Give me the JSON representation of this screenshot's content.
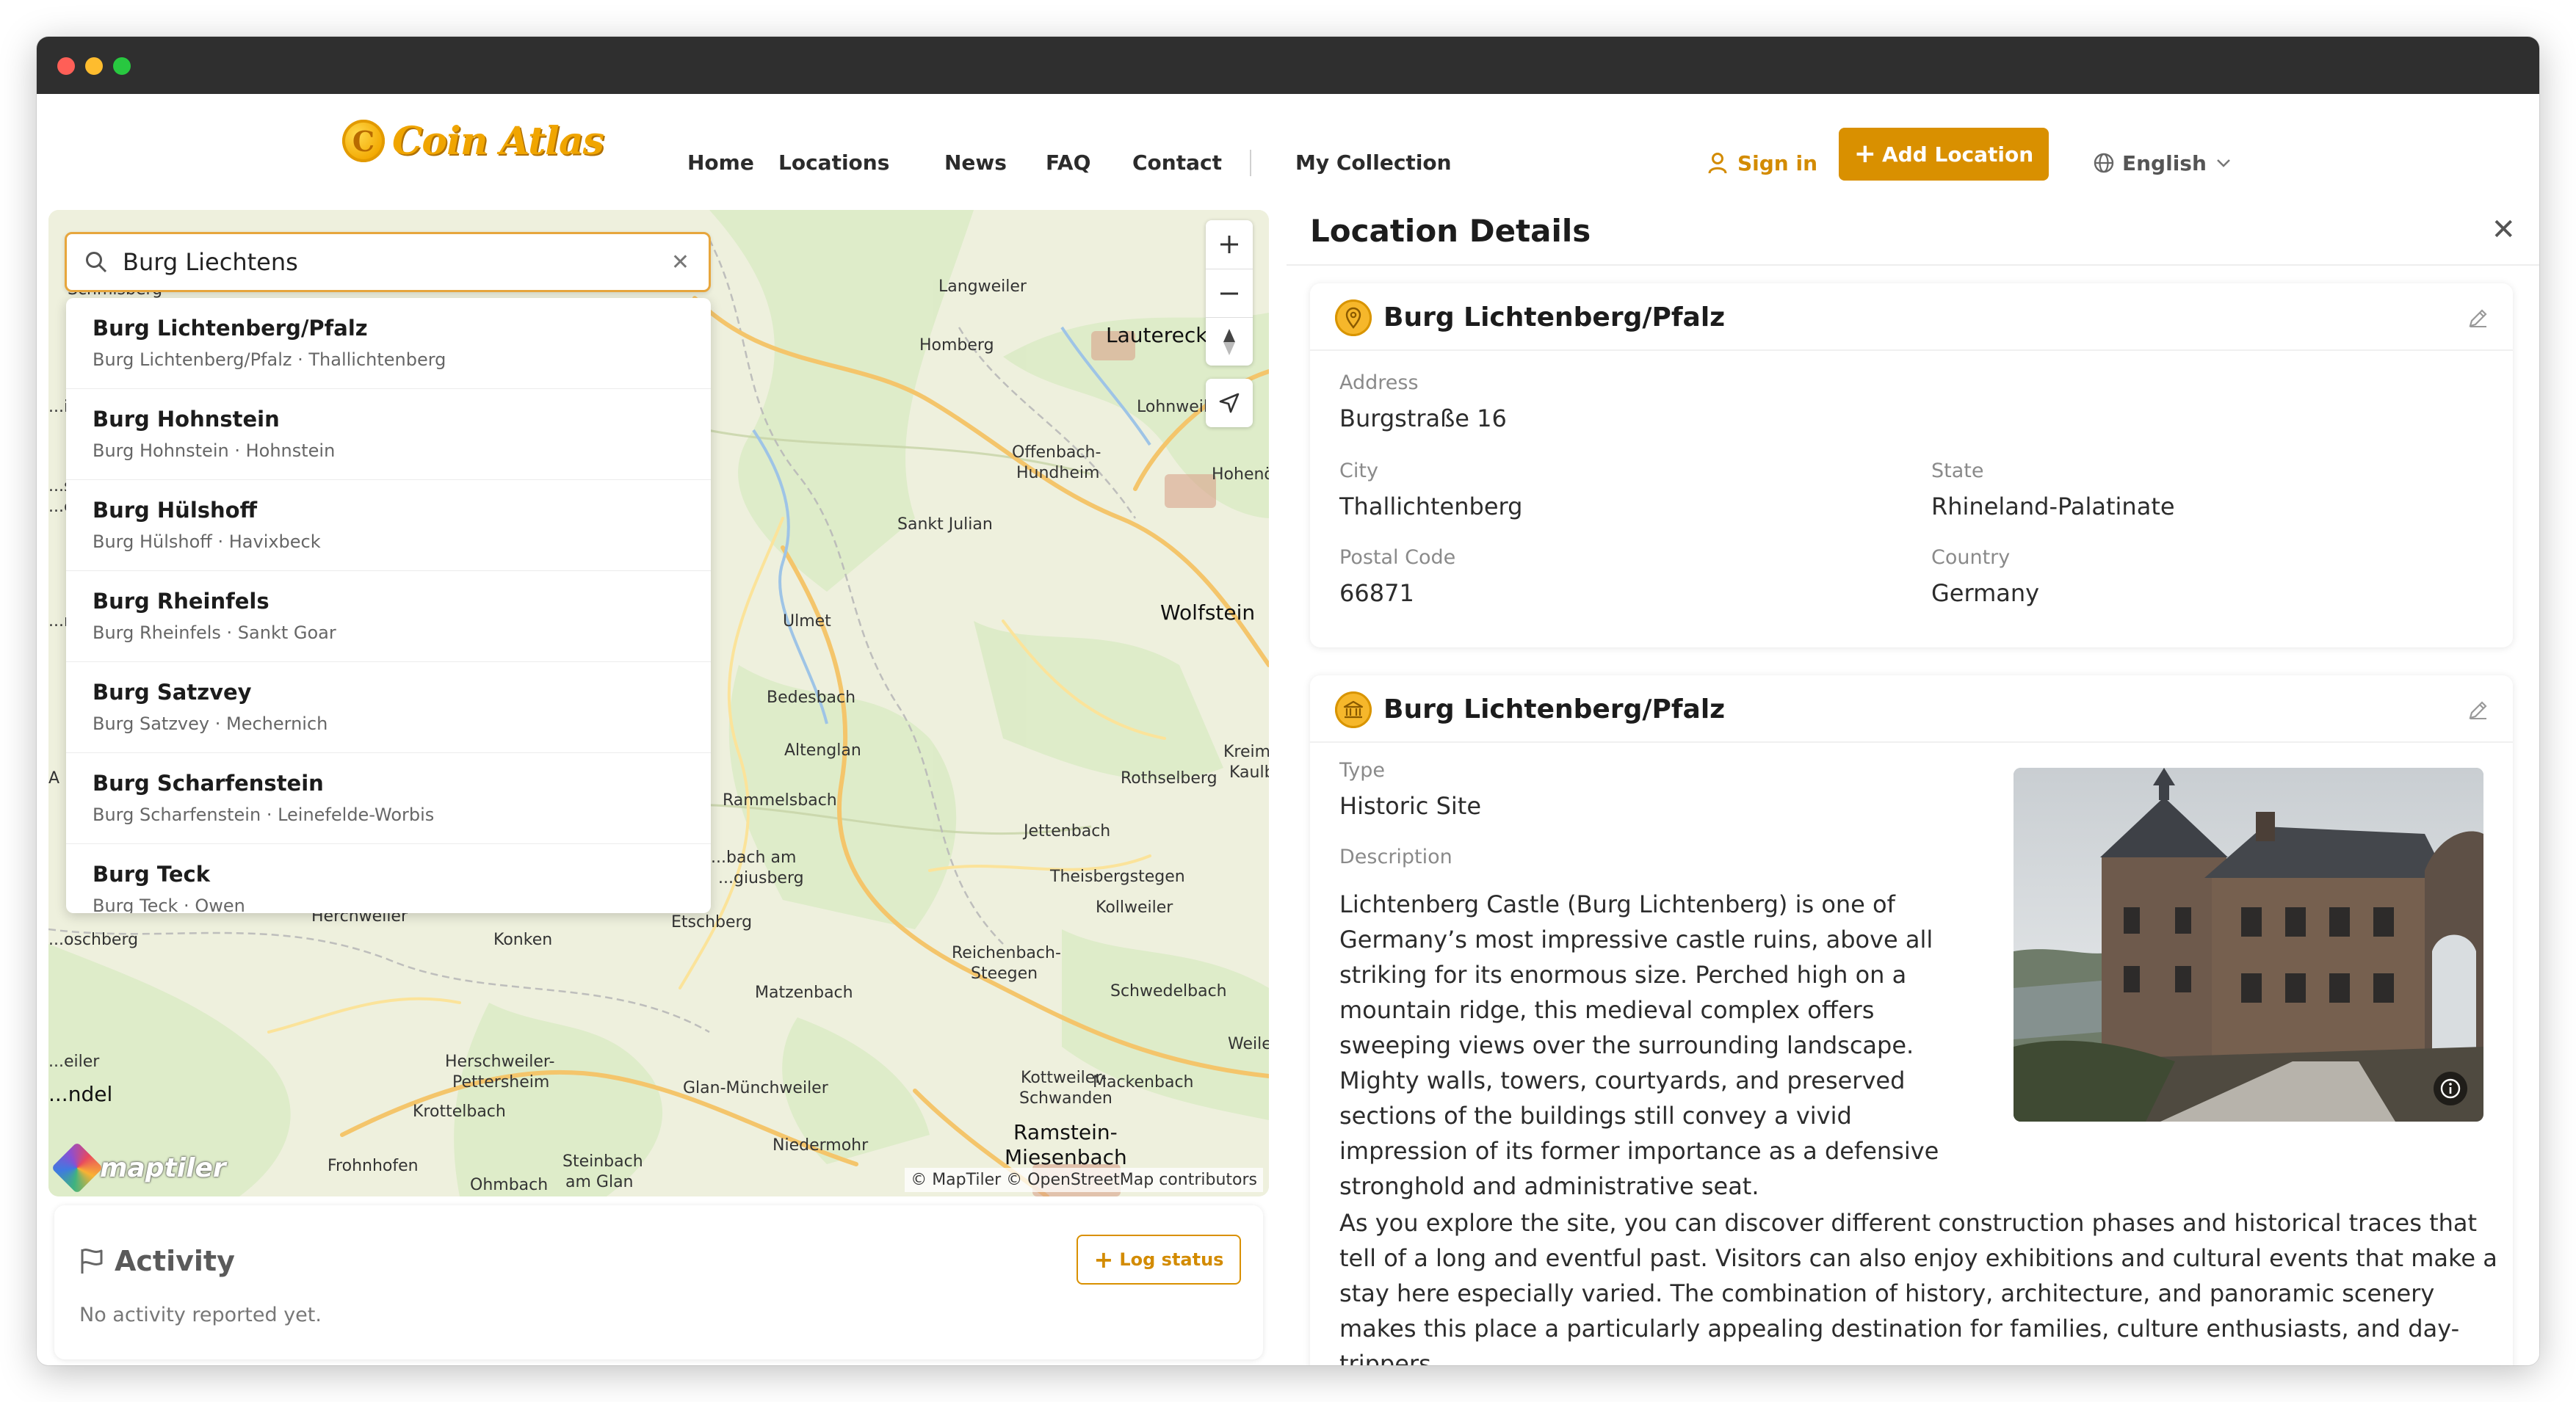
{
  "brand": {
    "name": "Coin Atlas",
    "coin_glyph": "C",
    "accent": "#d99000"
  },
  "nav": {
    "items": [
      {
        "label": "Home"
      },
      {
        "label": "Locations"
      },
      {
        "label": "News"
      },
      {
        "label": "FAQ"
      },
      {
        "label": "Contact"
      },
      {
        "label": "My Collection"
      }
    ],
    "sign_in": "Sign in",
    "add_location": "Add Location",
    "language": "English"
  },
  "search": {
    "value": "Burg Liechtens",
    "results": [
      {
        "title": "Burg Lichtenberg/Pfalz",
        "subtitle": "Burg Lichtenberg/Pfalz · Thallichtenberg"
      },
      {
        "title": "Burg Hohnstein",
        "subtitle": "Burg Hohnstein · Hohnstein"
      },
      {
        "title": "Burg Hülshoff",
        "subtitle": "Burg Hülshoff · Havixbeck"
      },
      {
        "title": "Burg Rheinfels",
        "subtitle": "Burg Rheinfels · Sankt Goar"
      },
      {
        "title": "Burg Satzvey",
        "subtitle": "Burg Satzvey · Mechernich"
      },
      {
        "title": "Burg Scharfenstein",
        "subtitle": "Burg Scharfenstein · Leinefelde-Worbis"
      },
      {
        "title": "Burg Teck",
        "subtitle": "Burg Teck · Owen"
      }
    ]
  },
  "map": {
    "labels": [
      {
        "text": "Schmisberg"
      },
      {
        "text": "Langweiler"
      },
      {
        "text": "Homberg"
      },
      {
        "text": "Lauterecken"
      },
      {
        "text": "Lohnweiler"
      },
      {
        "text": "Offenbach-"
      },
      {
        "text": "Hundheim"
      },
      {
        "text": "Hohenöllen"
      },
      {
        "text": "Sankt Julian"
      },
      {
        "text": "Ulmet"
      },
      {
        "text": "Wolfstein"
      },
      {
        "text": "Bedesbach"
      },
      {
        "text": "Altenglan"
      },
      {
        "text": "Rothselberg"
      },
      {
        "text": "Kreimbach-"
      },
      {
        "text": "Kaulbach"
      },
      {
        "text": "Rammelsbach"
      },
      {
        "text": "Jettenbach"
      },
      {
        "text": "Theisbergstegen"
      },
      {
        "text": "...bach am"
      },
      {
        "text": "...giusberg"
      },
      {
        "text": "Kollweiler"
      },
      {
        "text": "Herchweiler"
      },
      {
        "text": "Konken"
      },
      {
        "text": "Etschberg"
      },
      {
        "text": "...oschberg"
      },
      {
        "text": "Reichenbach-"
      },
      {
        "text": "Steegen"
      },
      {
        "text": "Matzenbach"
      },
      {
        "text": "Schwedelbach"
      },
      {
        "text": "Weilerbach"
      },
      {
        "text": "Herschweiler-"
      },
      {
        "text": "Pettersheim"
      },
      {
        "text": "Glan-Münchweiler"
      },
      {
        "text": "Kottweiler-"
      },
      {
        "text": "Schwanden"
      },
      {
        "text": "Mackenbach"
      },
      {
        "text": "...eiler"
      },
      {
        "text": "...ndel"
      },
      {
        "text": "Krottelbach"
      },
      {
        "text": "Niedermohr"
      },
      {
        "text": "Ramstein-"
      },
      {
        "text": "Miesenbach"
      },
      {
        "text": "Frohnhofen"
      },
      {
        "text": "Ohmbach"
      },
      {
        "text": "Steinbach"
      },
      {
        "text": "am Glan"
      },
      {
        "text": "...ist"
      },
      {
        "text": "...sta"
      },
      {
        "text": "...ers"
      },
      {
        "text": "...ml"
      },
      {
        "text": "A"
      }
    ],
    "attribution": "© MapTiler © OpenStreetMap contributors",
    "provider_logo": "maptiler"
  },
  "activity": {
    "title": "Activity",
    "empty": "No activity reported yet.",
    "log_button": "Log status"
  },
  "details": {
    "title": "Location Details",
    "address_card": {
      "title": "Burg Lichtenberg/Pfalz",
      "fields": [
        {
          "label": "Address",
          "value": "Burgstraße 16"
        },
        {
          "label": "City",
          "value": "Thallichtenberg"
        },
        {
          "label": "State",
          "value": "Rhineland-Palatinate"
        },
        {
          "label": "Postal Code",
          "value": "66871"
        },
        {
          "label": "Country",
          "value": "Germany"
        }
      ]
    },
    "site_card": {
      "title": "Burg Lichtenberg/Pfalz",
      "type_label": "Type",
      "type_value": "Historic Site",
      "description_label": "Description",
      "description_1": "Lichtenberg Castle (Burg Lichtenberg) is one of Germany’s most impressive castle ruins, above all striking for its enormous size. Perched high on a mountain ridge, this medieval complex offers sweeping views over the surrounding landscape. Mighty walls, towers, courtyards, and preserved sections of the buildings still convey a vivid impression of its former importance as a defensive stronghold and administrative seat.",
      "description_2": "As you explore the site, you can discover different construction phases and historical traces that tell of a long and eventful past. Visitors can also enjoy exhibitions and cultural events that make a stay here especially varied. The combination of history, architecture, and panoramic scenery makes this place a particularly appealing destination for families, culture enthusiasts, and day-trippers."
    }
  }
}
